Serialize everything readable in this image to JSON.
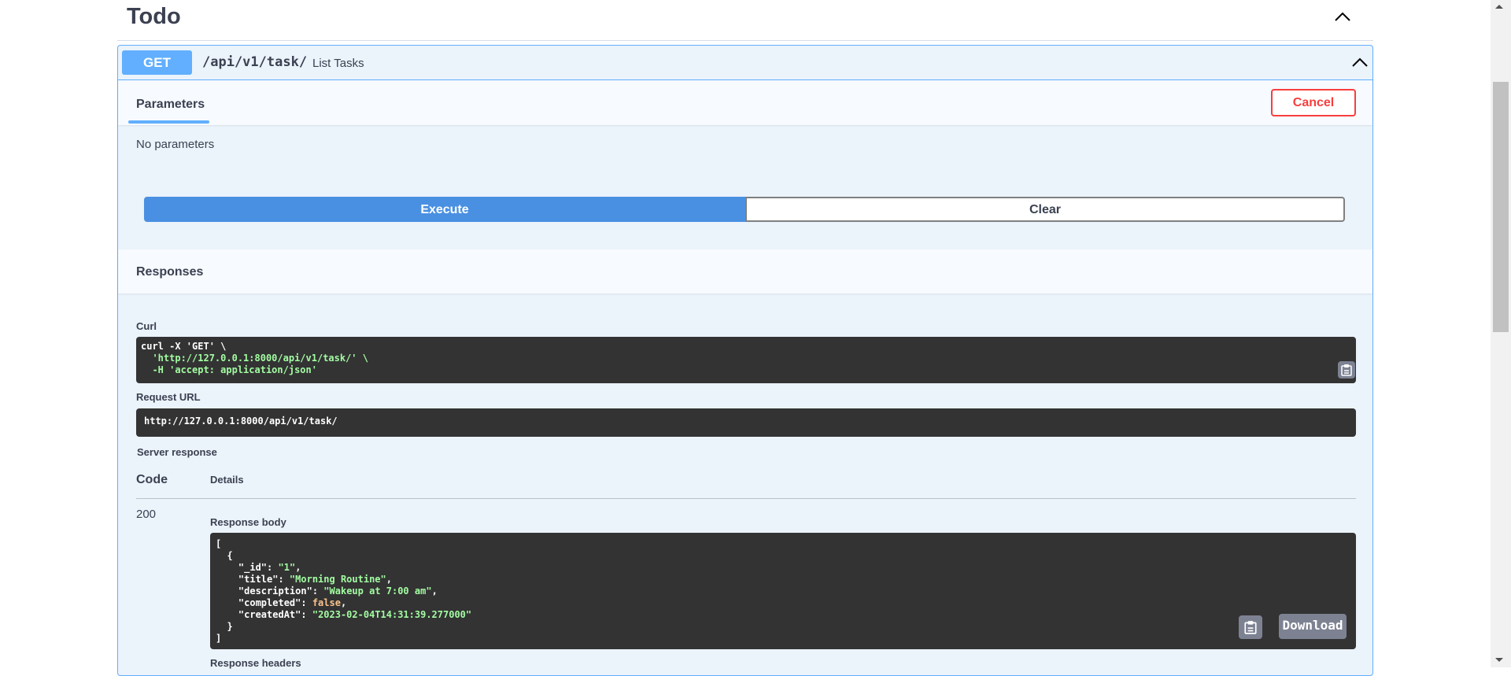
{
  "tag": {
    "title": "Todo"
  },
  "operation": {
    "method": "GET",
    "path": "/api/v1/task/",
    "summary": "List Tasks"
  },
  "parameters": {
    "tab_label": "Parameters",
    "cancel_label": "Cancel",
    "empty_text": "No parameters"
  },
  "actions": {
    "execute_label": "Execute",
    "clear_label": "Clear"
  },
  "responses": {
    "title": "Responses",
    "curl_label": "Curl",
    "curl_lines": [
      "curl -X 'GET' \\",
      "  'http://127.0.0.1:8000/api/v1/task/' \\",
      "  -H 'accept: application/json'"
    ],
    "request_url_label": "Request URL",
    "request_url": "http://127.0.0.1:8000/api/v1/task/",
    "server_response_label": "Server response",
    "code_header": "Code",
    "details_header": "Details",
    "status_code": "200",
    "response_body_label": "Response body",
    "response_body": {
      "_id": "1",
      "title": "Morning Routine",
      "description": "Wakeup at 7:00 am",
      "completed": "false",
      "createdAt": "2023-02-04T14:31:39.277000"
    },
    "download_label": "Download",
    "response_headers_label": "Response headers"
  },
  "colors": {
    "get_accent": "#61affe",
    "execute_blue": "#4990e2",
    "cancel_red": "#f93e3e",
    "code_bg": "#333333"
  },
  "icons": {
    "collapse": "chevron-up-icon",
    "copy": "clipboard-icon"
  }
}
